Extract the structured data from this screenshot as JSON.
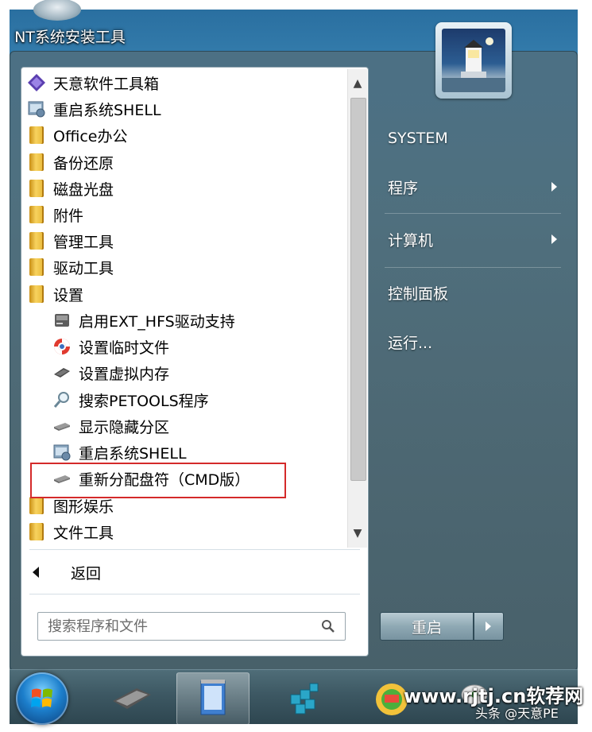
{
  "desktop": {
    "icon_label": "NT系统安装工具"
  },
  "start_menu": {
    "programs": [
      {
        "label": "天意软件工具箱",
        "icon": "toolbox-icon"
      },
      {
        "label": "重启系统SHELL",
        "icon": "restart-shell-icon"
      },
      {
        "label": "Office办公",
        "icon": "folder-icon"
      },
      {
        "label": "备份还原",
        "icon": "folder-icon"
      },
      {
        "label": "磁盘光盘",
        "icon": "folder-icon"
      },
      {
        "label": "附件",
        "icon": "folder-icon"
      },
      {
        "label": "管理工具",
        "icon": "folder-icon"
      },
      {
        "label": "驱动工具",
        "icon": "folder-icon"
      },
      {
        "label": "设置",
        "icon": "folder-icon"
      },
      {
        "label": "启用EXT_HFS驱动支持",
        "icon": "disk-drive-icon"
      },
      {
        "label": "设置临时文件",
        "icon": "lifebuoy-icon"
      },
      {
        "label": "设置虚拟内存",
        "icon": "memory-chip-icon"
      },
      {
        "label": "搜索PETOOLS程序",
        "icon": "magnifier-icon"
      },
      {
        "label": "显示隐藏分区",
        "icon": "hard-disk-icon"
      },
      {
        "label": "重启系统SHELL",
        "icon": "restart-shell-icon"
      },
      {
        "label": "重新分配盘符（CMD版）",
        "icon": "hard-disk-icon"
      },
      {
        "label": "图形娱乐",
        "icon": "folder-icon"
      },
      {
        "label": "文件工具",
        "icon": "folder-icon"
      }
    ],
    "back_label": "返回",
    "search_placeholder": "搜索程序和文件",
    "right": {
      "user": "SYSTEM",
      "programs": "程序",
      "computer": "计算机",
      "control_panel": "控制面板",
      "run": "运行..."
    },
    "restart_label": "重启"
  },
  "watermark": {
    "site": "www.rjtj.cn软荐网",
    "author": "头条 @天意PE"
  },
  "colors": {
    "highlight": "#d42a2a",
    "folder": "#f0c040"
  }
}
